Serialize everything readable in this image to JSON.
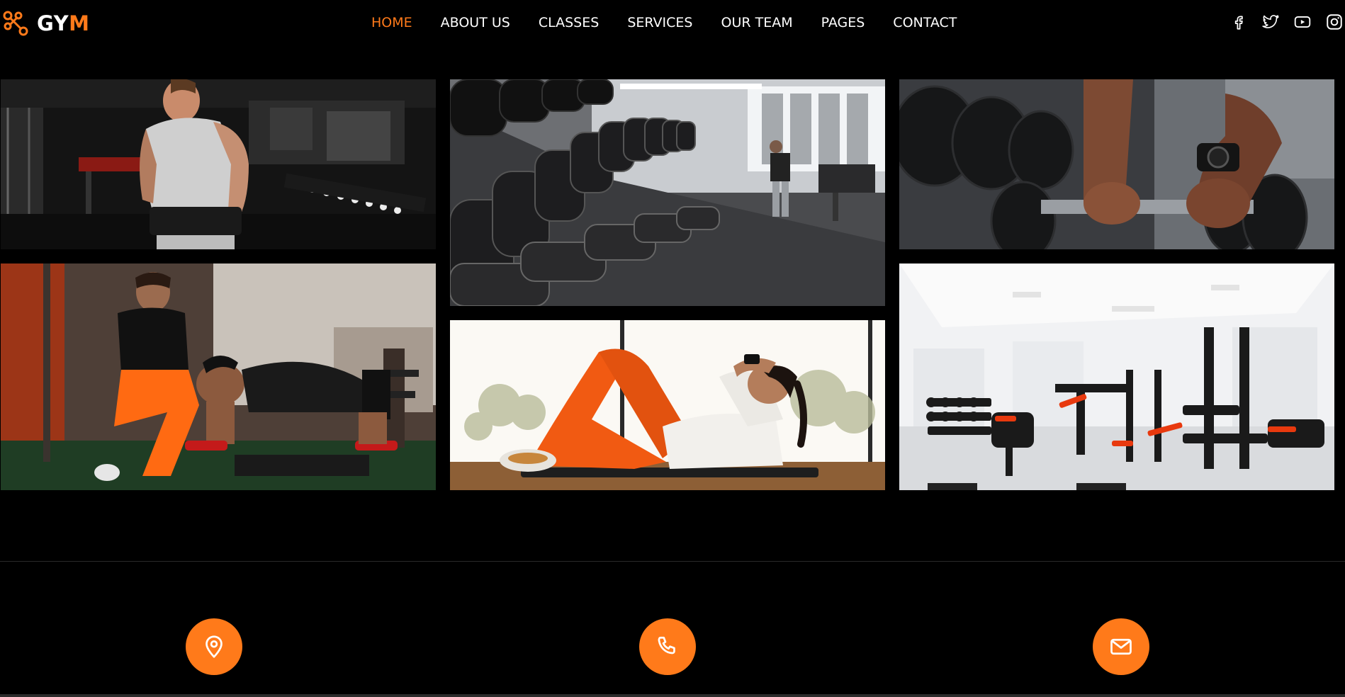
{
  "brand": {
    "name_part1": "GY",
    "name_part2": "M",
    "accent_color": "#ff7a1a",
    "logo_icon": "dumbbell-logo-icon"
  },
  "nav": {
    "items": [
      {
        "label": "HOME",
        "active": true
      },
      {
        "label": "ABOUT US",
        "active": false
      },
      {
        "label": "CLASSES",
        "active": false
      },
      {
        "label": "SERVICES",
        "active": false
      },
      {
        "label": "OUR TEAM",
        "active": false
      },
      {
        "label": "PAGES",
        "active": false
      },
      {
        "label": "CONTACT",
        "active": false
      }
    ]
  },
  "social": {
    "icons": [
      "facebook-icon",
      "twitter-icon",
      "youtube-icon",
      "instagram-icon"
    ]
  },
  "gallery": {
    "images": [
      "man-with-lifting-belt-photo",
      "dumbbell-rack-photo",
      "hands-gripping-dumbbell-photo",
      "trainer-assisting-pushups-photo",
      "woman-doing-crunches-photo",
      "bright-gym-interior-photo"
    ]
  },
  "contact": {
    "icons": [
      "location-pin-icon",
      "phone-icon",
      "mail-icon"
    ]
  },
  "colors": {
    "background": "#000000",
    "text": "#ffffff",
    "accent": "#ff7a1a"
  }
}
